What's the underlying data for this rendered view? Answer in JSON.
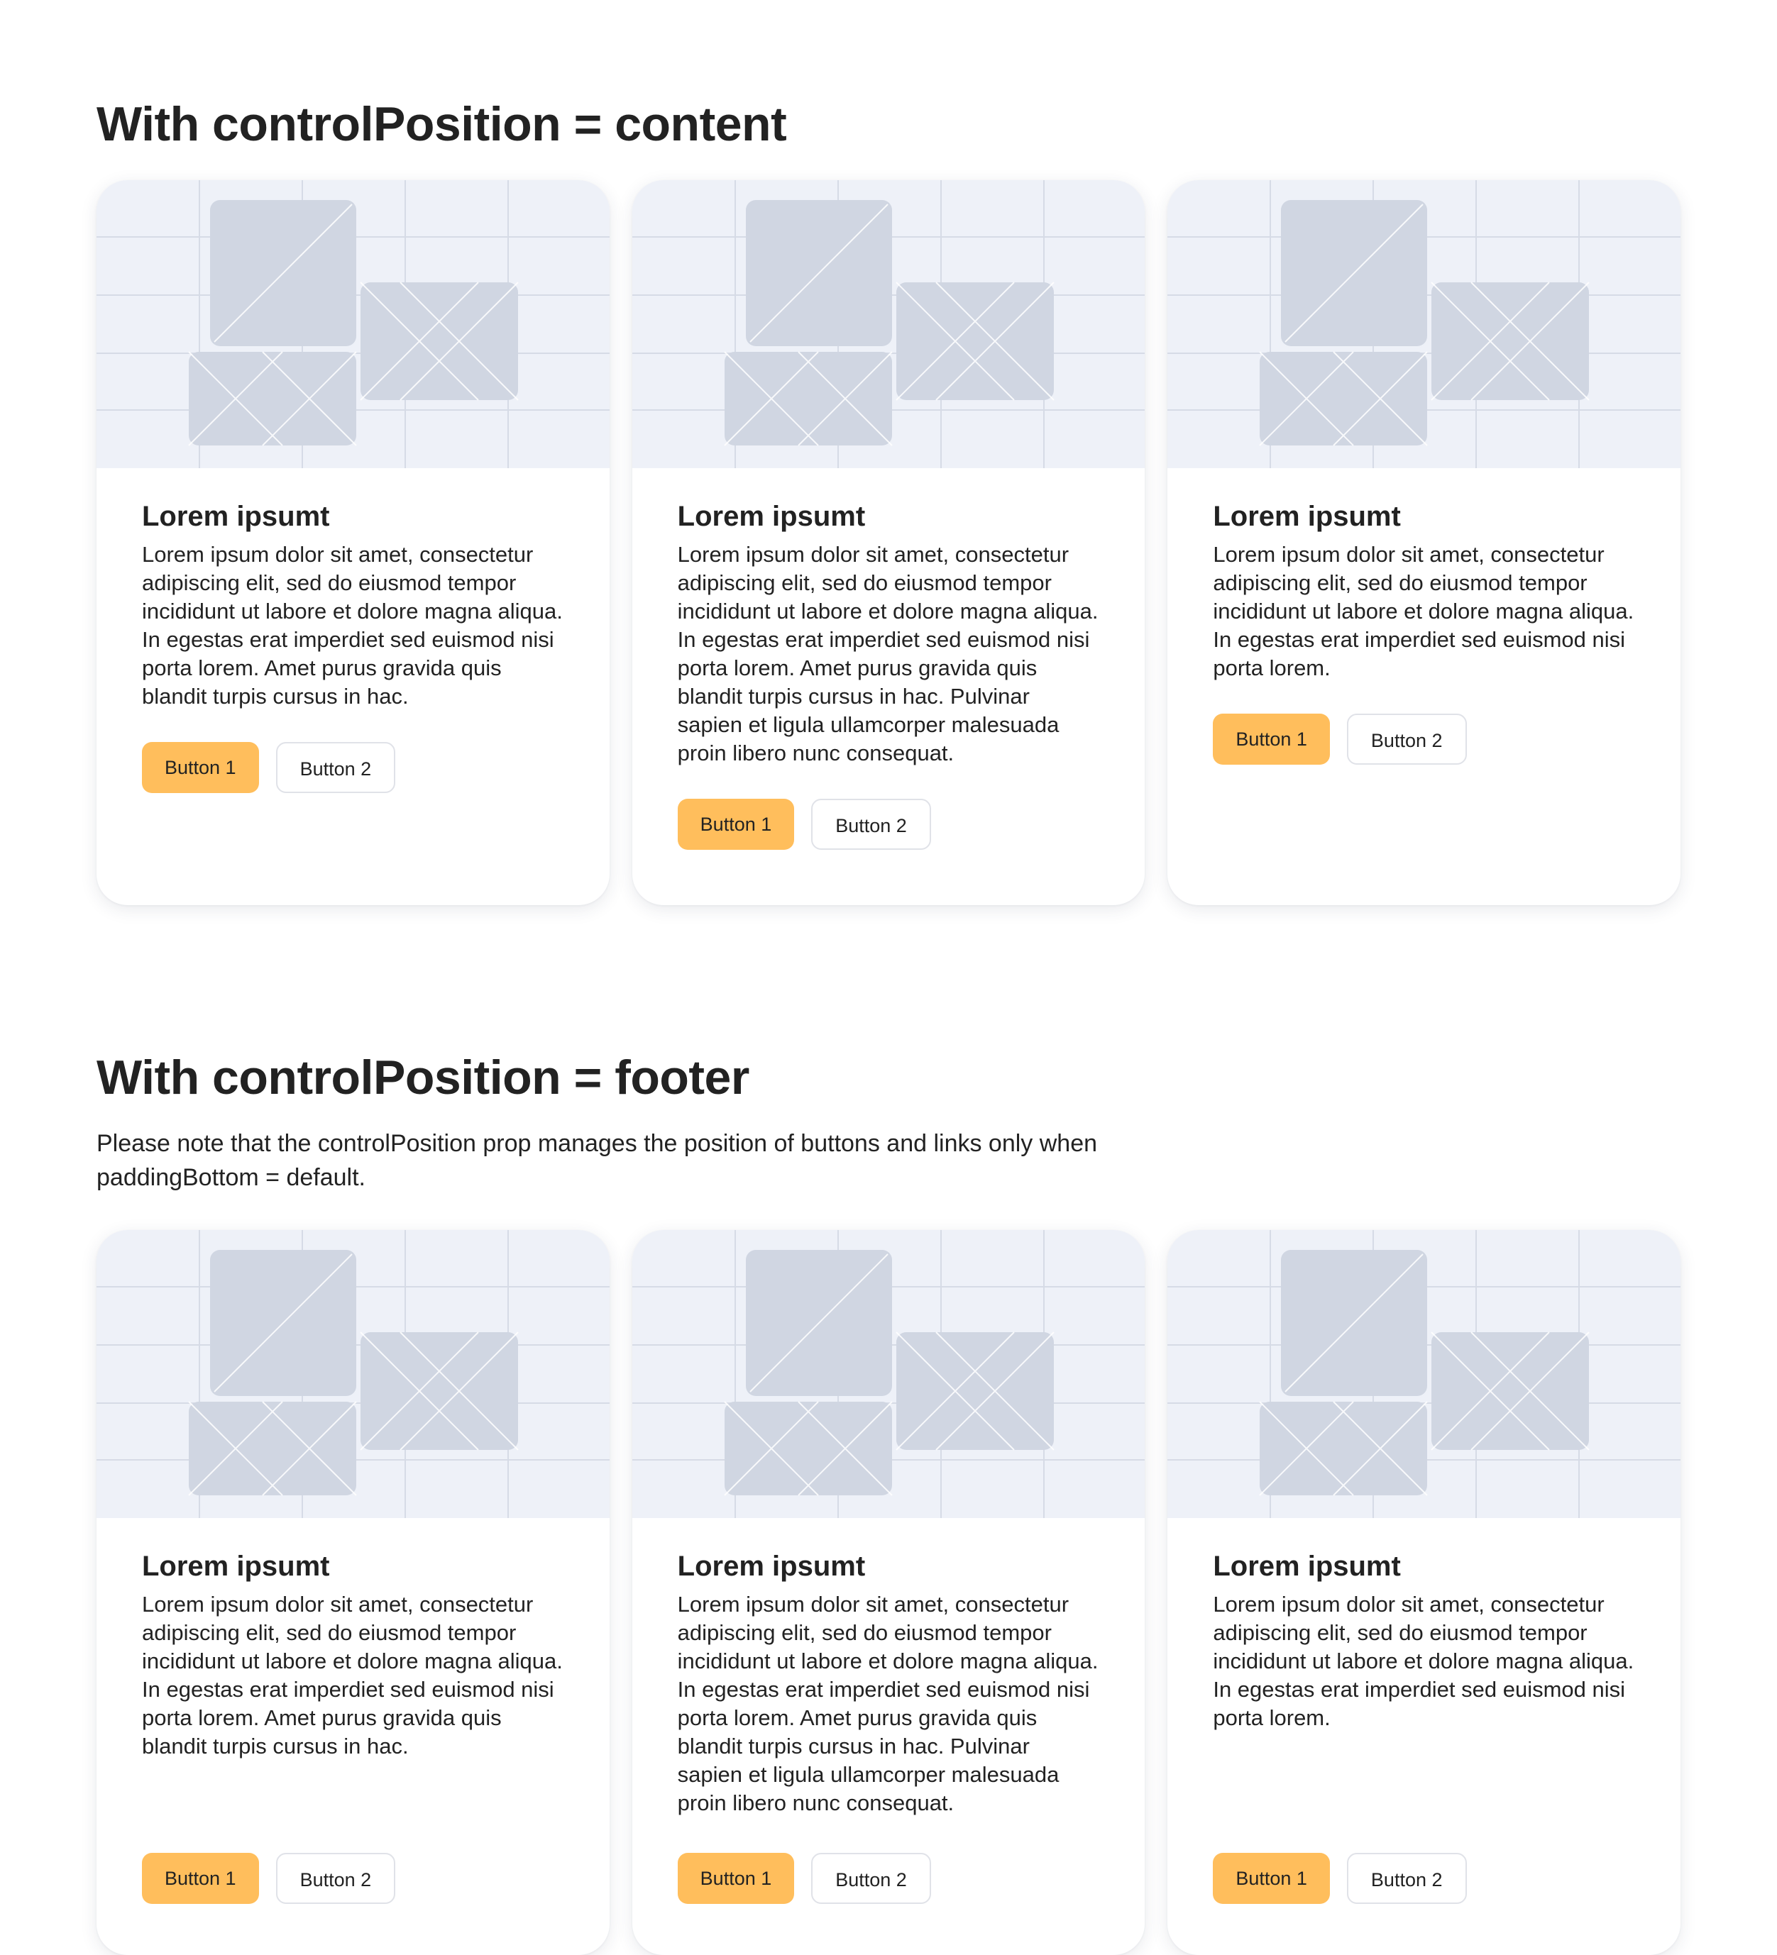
{
  "colors": {
    "primary_button": "#ffbe5c",
    "image_background": "#eef1f8",
    "image_shape": "#d0d6e2",
    "text": "#222222"
  },
  "sections": [
    {
      "title": "With controlPosition = content",
      "note": "",
      "control_position": "content",
      "cards": [
        {
          "title": "Lorem ipsumt",
          "text": "Lorem ipsum dolor sit amet, consectetur adipiscing elit, sed do eiusmod tempor incididunt ut labore et dolore magna aliqua. In egestas erat imperdiet sed euismod nisi porta lorem. Amet purus gravida quis blandit turpis cursus in hac.",
          "button1": "Button 1",
          "button2": "Button 2",
          "image_icon": "image-placeholder-icon"
        },
        {
          "title": "Lorem ipsumt",
          "text": "Lorem ipsum dolor sit amet, consectetur adipiscing elit, sed do eiusmod tempor incididunt ut labore et dolore magna aliqua. In egestas erat imperdiet sed euismod nisi porta lorem. Amet purus gravida quis blandit turpis cursus in hac. Pulvinar sapien et ligula ullamcorper malesuada proin libero nunc consequat.",
          "button1": "Button 1",
          "button2": "Button 2",
          "image_icon": "image-placeholder-icon"
        },
        {
          "title": "Lorem ipsumt",
          "text": "Lorem ipsum dolor sit amet, consectetur adipiscing elit, sed do eiusmod tempor incididunt ut labore et dolore magna aliqua. In egestas erat imperdiet sed euismod nisi porta lorem.",
          "button1": "Button 1",
          "button2": "Button 2",
          "image_icon": "image-placeholder-icon"
        }
      ]
    },
    {
      "title": "With controlPosition = footer",
      "note": "Please note that the controlPosition prop manages the position of buttons and links only when paddingBottom = default.",
      "control_position": "footer",
      "cards": [
        {
          "title": "Lorem ipsumt",
          "text": "Lorem ipsum dolor sit amet, consectetur adipiscing elit, sed do eiusmod tempor incididunt ut labore et dolore magna aliqua. In egestas erat imperdiet sed euismod nisi porta lorem. Amet purus gravida quis blandit turpis cursus in hac.",
          "button1": "Button 1",
          "button2": "Button 2",
          "image_icon": "image-placeholder-icon"
        },
        {
          "title": "Lorem ipsumt",
          "text": "Lorem ipsum dolor sit amet, consectetur adipiscing elit, sed do eiusmod tempor incididunt ut labore et dolore magna aliqua. In egestas erat imperdiet sed euismod nisi porta lorem. Amet purus gravida quis blandit turpis cursus in hac. Pulvinar sapien et ligula ullamcorper malesuada proin libero nunc consequat.",
          "button1": "Button 1",
          "button2": "Button 2",
          "image_icon": "image-placeholder-icon"
        },
        {
          "title": "Lorem ipsumt",
          "text": "Lorem ipsum dolor sit amet, consectetur adipiscing elit, sed do eiusmod tempor incididunt ut labore et dolore magna aliqua. In egestas erat imperdiet sed euismod nisi porta lorem.",
          "button1": "Button 1",
          "button2": "Button 2",
          "image_icon": "image-placeholder-icon"
        }
      ]
    }
  ]
}
